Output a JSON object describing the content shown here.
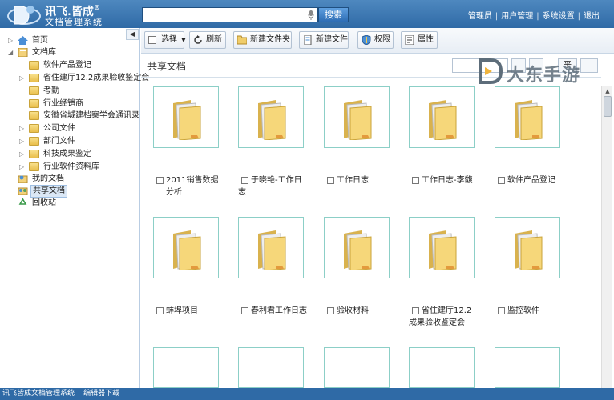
{
  "header": {
    "logo_line1": "讯飞.皆成",
    "logo_line2": "文档管理系统",
    "logo_reg": "®",
    "search_button": "搜索",
    "nav": [
      "管理员",
      "用户管理",
      "系统设置",
      "退出"
    ]
  },
  "sidebar": {
    "collapse_glyph": "◀",
    "items": [
      {
        "label": "首页"
      },
      {
        "label": "文档库"
      },
      {
        "label": "软件产品登记"
      },
      {
        "label": "省住建厅12.2成果验收鉴定会"
      },
      {
        "label": "考勤"
      },
      {
        "label": "行业经销商"
      },
      {
        "label": "安徽省城建档案学会通讯录"
      },
      {
        "label": "公司文件"
      },
      {
        "label": "部门文件"
      },
      {
        "label": "科技成果鉴定"
      },
      {
        "label": "行业软件资料库"
      },
      {
        "label": "我的文档"
      },
      {
        "label": "共享文档"
      },
      {
        "label": "回收站"
      }
    ]
  },
  "toolbar": {
    "select": "选择",
    "refresh": "刷新",
    "new_folder": "新建文件夹",
    "new_file": "新建文件",
    "permissions": "权限",
    "properties": "属性"
  },
  "content": {
    "title": "共享文档",
    "view_label": "平"
  },
  "watermark": "大东手游",
  "items": [
    {
      "label": "2011销售数据分析"
    },
    {
      "label": "于晓艳-工作日志"
    },
    {
      "label": "工作日志"
    },
    {
      "label": "工作日志-李馥"
    },
    {
      "label": "软件产品登记"
    },
    {
      "label": "蚌埠项目"
    },
    {
      "label": "春利君工作日志"
    },
    {
      "label": "验收材料"
    },
    {
      "label": "省住建厅12.2成果验收鉴定会"
    },
    {
      "label": "监控软件"
    }
  ],
  "status": {
    "app_name": "讯飞皆成文档管理系统",
    "link": "编辑器下载"
  },
  "colors": {
    "header_blue": "#2f6aa6",
    "folder_yellow": "#e9be4b",
    "thumb_border": "#8ccfc7"
  }
}
